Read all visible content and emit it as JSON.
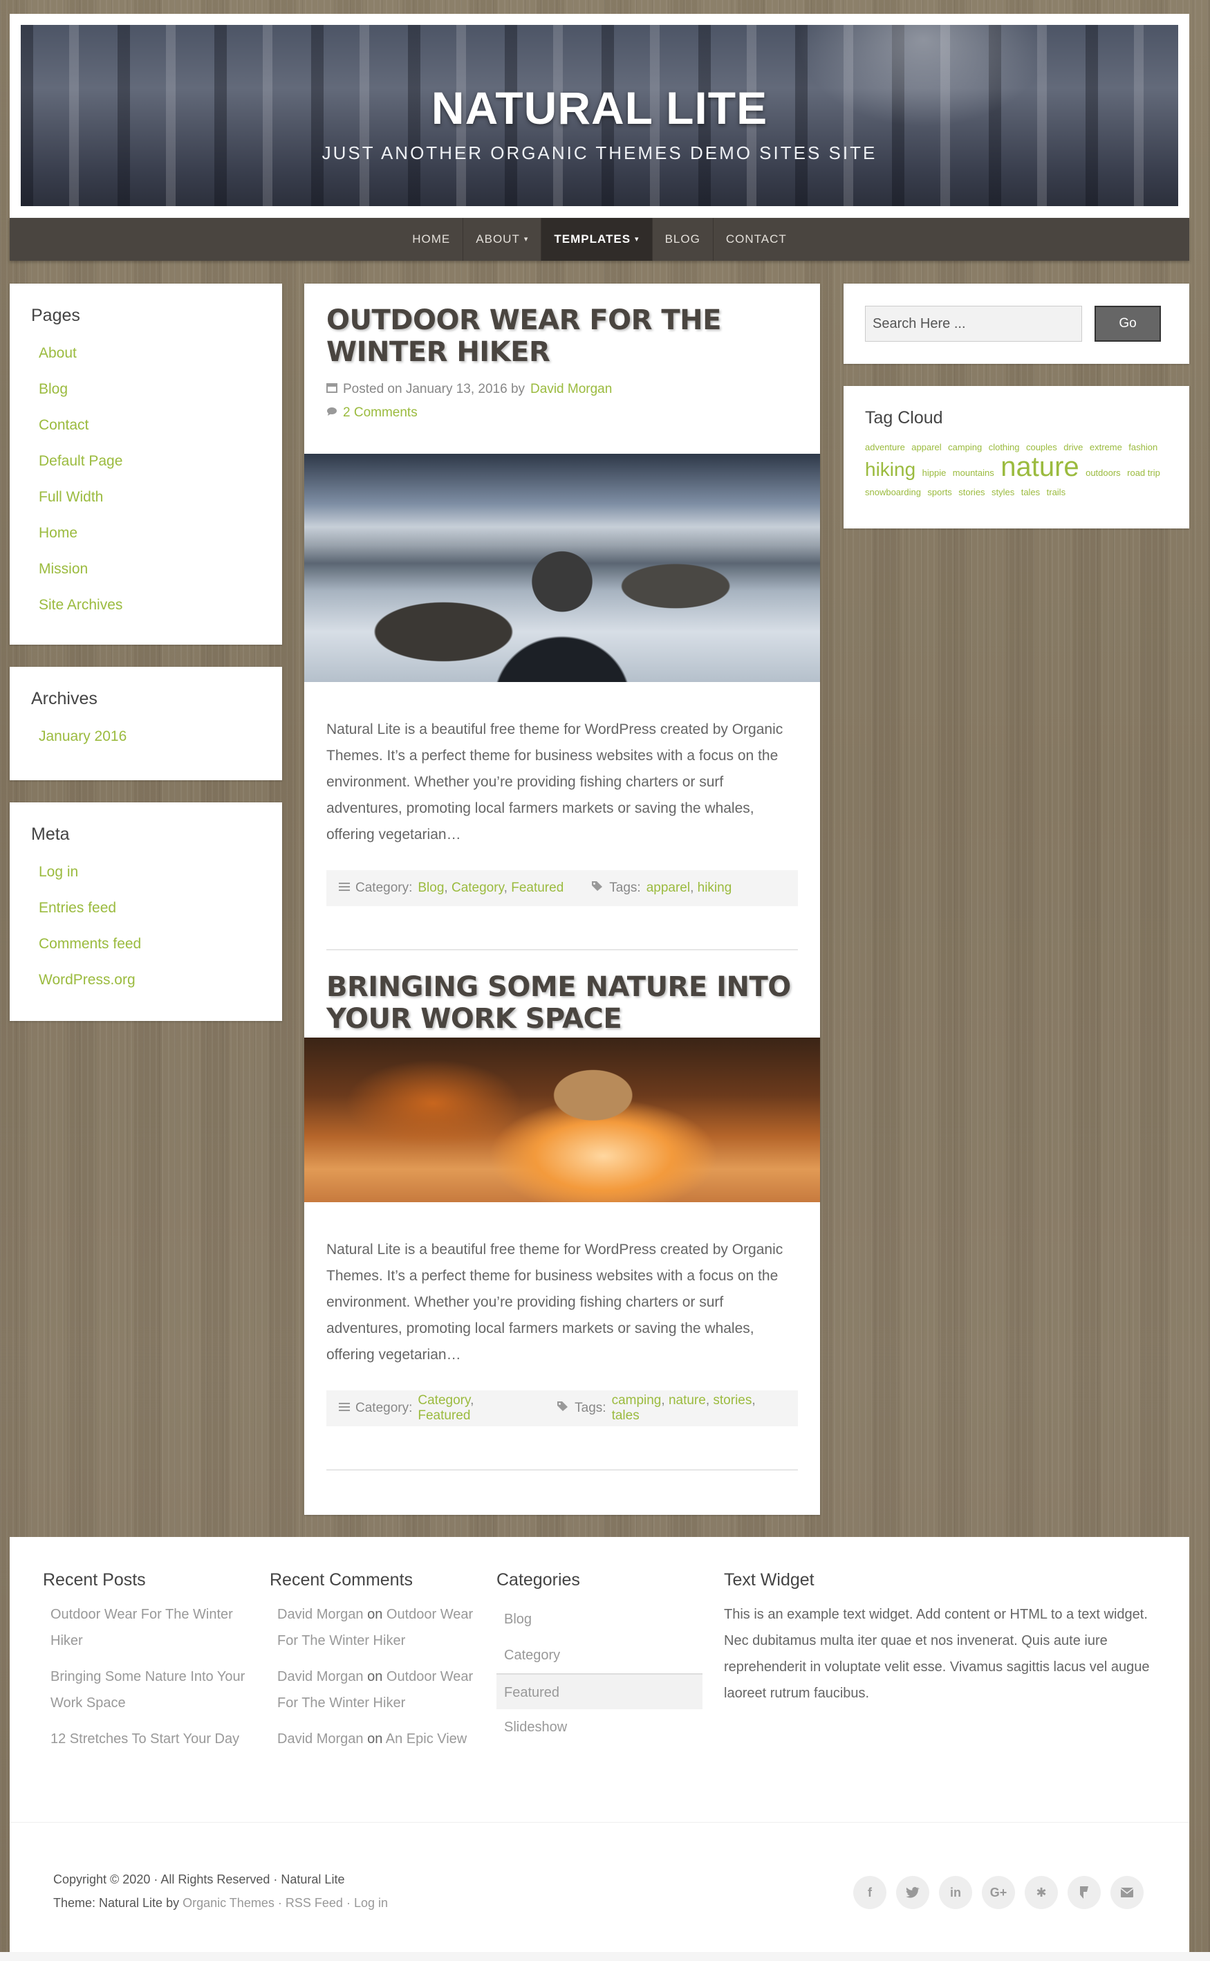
{
  "header": {
    "title": "NATURAL LITE",
    "description": "JUST ANOTHER ORGANIC THEMES DEMO SITES SITE"
  },
  "nav": {
    "items": [
      {
        "label": "HOME"
      },
      {
        "label": "ABOUT"
      },
      {
        "label": "TEMPLATES"
      },
      {
        "label": "BLOG"
      },
      {
        "label": "CONTACT"
      }
    ]
  },
  "sidebar_left": {
    "pages": {
      "title": "Pages",
      "items": [
        "About",
        "Blog",
        "Contact",
        "Default Page",
        "Full Width",
        "Home",
        "Mission",
        "Site Archives"
      ]
    },
    "archives": {
      "title": "Archives",
      "items": [
        "January 2016"
      ]
    },
    "meta": {
      "title": "Meta",
      "items": [
        "Log in",
        "Entries feed",
        "Comments feed",
        "WordPress.org"
      ]
    }
  },
  "sidebar_right": {
    "search": {
      "placeholder": "Search Here ...",
      "button": "Go"
    },
    "tagcloud": {
      "title": "Tag Cloud",
      "tags": [
        "adventure",
        "apparel",
        "camping",
        "clothing",
        "couples",
        "drive",
        "extreme",
        "fashion",
        "hiking",
        "hippie",
        "mountains",
        "nature",
        "outdoors",
        "road trip",
        "snowboarding",
        "sports",
        "stories",
        "styles",
        "tales",
        "trails"
      ]
    }
  },
  "posts": [
    {
      "title": "OUTDOOR WEAR FOR THE WINTER HIKER",
      "posted_prefix": "Posted on January 13, 2016 by",
      "author": "David Morgan",
      "comments": "2 Comments",
      "excerpt": "Natural Lite is a beautiful free theme for WordPress created by Organic Themes. It’s a perfect theme for business websites with a focus on the environment. Whether you’re providing fishing charters or surf adventures, promoting local farmers markets or saving the whales, offering vegetarian…",
      "category_label": "Category:",
      "categories": [
        "Blog",
        "Category",
        "Featured"
      ],
      "tags_label": "Tags:",
      "tags": [
        "apparel",
        "hiking"
      ]
    },
    {
      "title": "BRINGING SOME NATURE INTO YOUR WORK SPACE",
      "excerpt": "Natural Lite is a beautiful free theme for WordPress created by Organic Themes. It’s a perfect theme for business websites with a focus on the environment. Whether you’re providing fishing charters or surf adventures, promoting local farmers markets or saving the whales, offering vegetarian…",
      "category_label": "Category:",
      "categories": [
        "Category",
        "Featured"
      ],
      "tags_label": "Tags:",
      "tags": [
        "camping",
        "nature",
        "stories",
        "tales"
      ]
    }
  ],
  "footer": {
    "recent_posts": {
      "title": "Recent Posts",
      "items": [
        "Outdoor Wear For The Winter Hiker",
        "Bringing Some Nature Into Your Work Space",
        "12 Stretches To Start Your Day"
      ]
    },
    "recent_comments": {
      "title": "Recent Comments",
      "items": [
        {
          "author": "David Morgan",
          "on": "on",
          "post": "Outdoor Wear For The Winter Hiker"
        },
        {
          "author": "David Morgan",
          "on": "on",
          "post": "Outdoor Wear For The Winter Hiker"
        },
        {
          "author": "David Morgan",
          "on": "on",
          "post": "An Epic View"
        }
      ]
    },
    "categories": {
      "title": "Categories",
      "items": [
        "Blog",
        "Category",
        "Featured",
        "Slideshow"
      ]
    },
    "text_widget": {
      "title": "Text Widget",
      "body": "This is an example text widget. Add content or HTML to a text widget. Nec dubitamus multa iter quae et nos invenerat. Quis aute iure reprehenderit in voluptate velit esse. Vivamus sagittis lacus vel augue laoreet rutrum faucibus."
    },
    "copyright": "Copyright © 2020 · All Rights Reserved · Natural Lite",
    "theme_prefix": "Theme: Natural Lite by",
    "theme_link": "Organic Themes",
    "sep": "·",
    "rss": "RSS Feed",
    "login": "Log in",
    "social_icons": [
      "facebook-icon",
      "twitter-icon",
      "linkedin-icon",
      "google-plus-icon",
      "yelp-icon",
      "foursquare-icon",
      "email-icon"
    ]
  },
  "colors": {
    "accent": "#9bbb3f",
    "nav_bg": "#4a4540",
    "nav_active_bg": "#302c29",
    "title_color": "#4a4540"
  }
}
